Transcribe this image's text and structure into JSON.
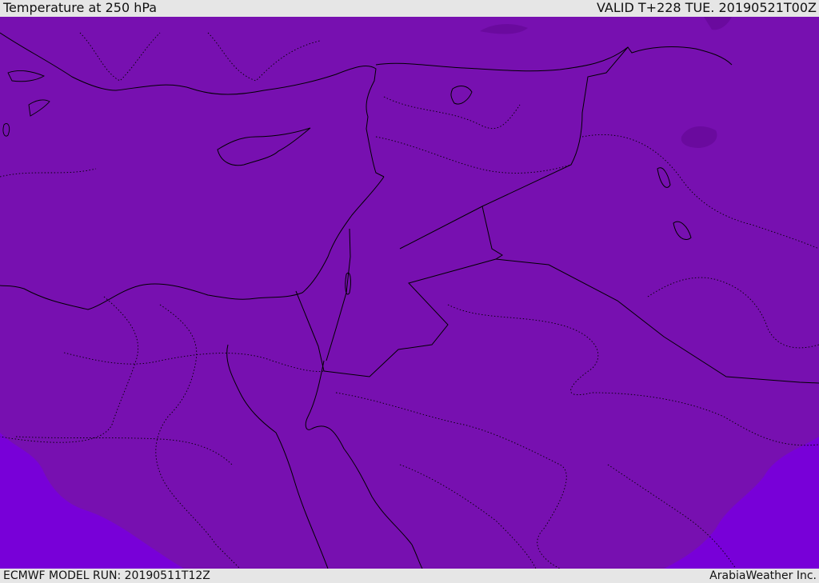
{
  "header": {
    "title": "Temperature at 250 hPa",
    "valid": "VALID T+228 TUE. 20190521T00Z"
  },
  "footer": {
    "model_run": "ECMWF MODEL RUN: 20190511T12Z",
    "credit": "ArabiaWeather Inc."
  },
  "map": {
    "colors": {
      "field_main": "#7710b0",
      "field_warmer": "#7800d8",
      "field_colder": "#6a0a9e",
      "coastline": "#000000",
      "borders": "#000000"
    },
    "region": "Eastern Mediterranean, Levant, Egypt, Arabia"
  }
}
